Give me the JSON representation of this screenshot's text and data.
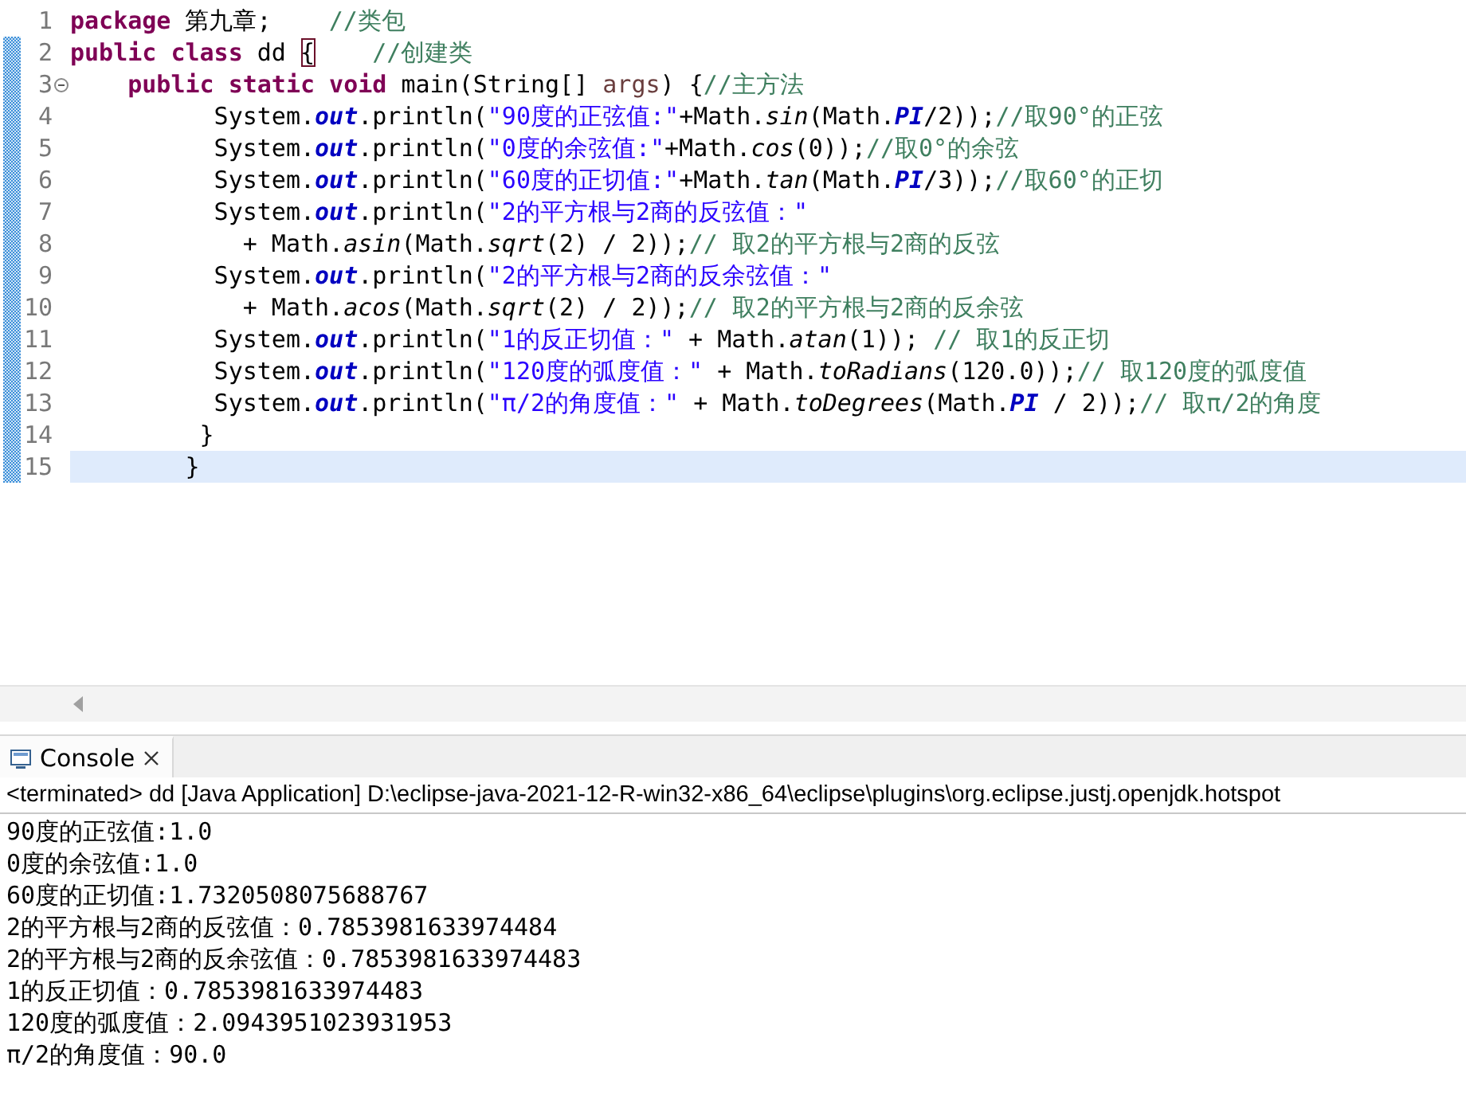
{
  "editor": {
    "lines": [
      {
        "number": "1",
        "changed": false,
        "current": false,
        "fold": false,
        "tokens": [
          {
            "kind": "keyword",
            "text": "package"
          },
          {
            "kind": "plain",
            "text": " 第九章;    "
          },
          {
            "kind": "comment",
            "text": "//类包"
          }
        ]
      },
      {
        "number": "2",
        "changed": true,
        "current": false,
        "fold": false,
        "tokens": [
          {
            "kind": "keyword",
            "text": "public class"
          },
          {
            "kind": "plain",
            "text": " dd "
          },
          {
            "kind": "bracket",
            "text": "{"
          },
          {
            "kind": "comment",
            "text": "    //创建类"
          }
        ]
      },
      {
        "number": "3",
        "changed": true,
        "current": false,
        "fold": true,
        "tokens": [
          {
            "kind": "keyword",
            "text": "    public static void"
          },
          {
            "kind": "plain",
            "text": " main(String[] "
          },
          {
            "kind": "param",
            "text": "args"
          },
          {
            "kind": "plain",
            "text": ") {"
          },
          {
            "kind": "comment",
            "text": "//主方法"
          }
        ]
      },
      {
        "number": "4",
        "changed": true,
        "current": false,
        "fold": false,
        "tokens": [
          {
            "kind": "plain",
            "text": "          System."
          },
          {
            "kind": "field",
            "text": "out"
          },
          {
            "kind": "plain",
            "text": ".println("
          },
          {
            "kind": "string",
            "text": "\"90度的正弦值:\""
          },
          {
            "kind": "plain",
            "text": "+Math."
          },
          {
            "kind": "method",
            "text": "sin"
          },
          {
            "kind": "plain",
            "text": "(Math."
          },
          {
            "kind": "field",
            "text": "PI"
          },
          {
            "kind": "plain",
            "text": "/2));"
          },
          {
            "kind": "comment",
            "text": "//取90°的正弦"
          }
        ]
      },
      {
        "number": "5",
        "changed": true,
        "current": false,
        "fold": false,
        "tokens": [
          {
            "kind": "plain",
            "text": "          System."
          },
          {
            "kind": "field",
            "text": "out"
          },
          {
            "kind": "plain",
            "text": ".println("
          },
          {
            "kind": "string",
            "text": "\"0度的余弦值:\""
          },
          {
            "kind": "plain",
            "text": "+Math."
          },
          {
            "kind": "method",
            "text": "cos"
          },
          {
            "kind": "plain",
            "text": "(0));"
          },
          {
            "kind": "comment",
            "text": "//取0°的余弦"
          }
        ]
      },
      {
        "number": "6",
        "changed": true,
        "current": false,
        "fold": false,
        "tokens": [
          {
            "kind": "plain",
            "text": "          System."
          },
          {
            "kind": "field",
            "text": "out"
          },
          {
            "kind": "plain",
            "text": ".println("
          },
          {
            "kind": "string",
            "text": "\"60度的正切值:\""
          },
          {
            "kind": "plain",
            "text": "+Math."
          },
          {
            "kind": "method",
            "text": "tan"
          },
          {
            "kind": "plain",
            "text": "(Math."
          },
          {
            "kind": "field",
            "text": "PI"
          },
          {
            "kind": "plain",
            "text": "/3));"
          },
          {
            "kind": "comment",
            "text": "//取60°的正切"
          }
        ]
      },
      {
        "number": "7",
        "changed": true,
        "current": false,
        "fold": false,
        "tokens": [
          {
            "kind": "plain",
            "text": "          System."
          },
          {
            "kind": "field",
            "text": "out"
          },
          {
            "kind": "plain",
            "text": ".println("
          },
          {
            "kind": "string",
            "text": "\"2的平方根与2商的反弦值：\""
          }
        ]
      },
      {
        "number": "8",
        "changed": true,
        "current": false,
        "fold": false,
        "tokens": [
          {
            "kind": "plain",
            "text": "            + Math."
          },
          {
            "kind": "method",
            "text": "asin"
          },
          {
            "kind": "plain",
            "text": "(Math."
          },
          {
            "kind": "method",
            "text": "sqrt"
          },
          {
            "kind": "plain",
            "text": "(2) / 2));"
          },
          {
            "kind": "comment",
            "text": "// 取2的平方根与2商的反弦"
          }
        ]
      },
      {
        "number": "9",
        "changed": true,
        "current": false,
        "fold": false,
        "tokens": [
          {
            "kind": "plain",
            "text": "          System."
          },
          {
            "kind": "field",
            "text": "out"
          },
          {
            "kind": "plain",
            "text": ".println("
          },
          {
            "kind": "string",
            "text": "\"2的平方根与2商的反余弦值：\""
          }
        ]
      },
      {
        "number": "10",
        "changed": true,
        "current": false,
        "fold": false,
        "tokens": [
          {
            "kind": "plain",
            "text": "            + Math."
          },
          {
            "kind": "method",
            "text": "acos"
          },
          {
            "kind": "plain",
            "text": "(Math."
          },
          {
            "kind": "method",
            "text": "sqrt"
          },
          {
            "kind": "plain",
            "text": "(2) / 2));"
          },
          {
            "kind": "comment",
            "text": "// 取2的平方根与2商的反余弦"
          }
        ]
      },
      {
        "number": "11",
        "changed": true,
        "current": false,
        "fold": false,
        "tokens": [
          {
            "kind": "plain",
            "text": "          System."
          },
          {
            "kind": "field",
            "text": "out"
          },
          {
            "kind": "plain",
            "text": ".println("
          },
          {
            "kind": "string",
            "text": "\"1的反正切值：\""
          },
          {
            "kind": "plain",
            "text": " + Math."
          },
          {
            "kind": "method",
            "text": "atan"
          },
          {
            "kind": "plain",
            "text": "(1)); "
          },
          {
            "kind": "comment",
            "text": "// 取1的反正切"
          }
        ]
      },
      {
        "number": "12",
        "changed": true,
        "current": false,
        "fold": false,
        "tokens": [
          {
            "kind": "plain",
            "text": "          System."
          },
          {
            "kind": "field",
            "text": "out"
          },
          {
            "kind": "plain",
            "text": ".println("
          },
          {
            "kind": "string",
            "text": "\"120度的弧度值：\""
          },
          {
            "kind": "plain",
            "text": " + Math."
          },
          {
            "kind": "method",
            "text": "toRadians"
          },
          {
            "kind": "plain",
            "text": "(120.0));"
          },
          {
            "kind": "comment",
            "text": "// 取120度的弧度值"
          }
        ]
      },
      {
        "number": "13",
        "changed": true,
        "current": false,
        "fold": false,
        "tokens": [
          {
            "kind": "plain",
            "text": "          System."
          },
          {
            "kind": "field",
            "text": "out"
          },
          {
            "kind": "plain",
            "text": ".println("
          },
          {
            "kind": "string",
            "text": "\"π/2的角度值：\""
          },
          {
            "kind": "plain",
            "text": " + Math."
          },
          {
            "kind": "method",
            "text": "toDegrees"
          },
          {
            "kind": "plain",
            "text": "(Math."
          },
          {
            "kind": "field",
            "text": "PI"
          },
          {
            "kind": "plain",
            "text": " / 2));"
          },
          {
            "kind": "comment",
            "text": "// 取π/2的角度"
          }
        ]
      },
      {
        "number": "14",
        "changed": true,
        "current": false,
        "fold": false,
        "tokens": [
          {
            "kind": "plain",
            "text": "         }"
          }
        ]
      },
      {
        "number": "15",
        "changed": true,
        "current": true,
        "fold": false,
        "tokens": [
          {
            "kind": "plain",
            "text": "        }"
          }
        ]
      }
    ]
  },
  "console": {
    "tab": {
      "label": "Console",
      "selected": true
    },
    "header": "<terminated> dd [Java Application] D:\\eclipse-java-2021-12-R-win32-x86_64\\eclipse\\plugins\\org.eclipse.justj.openjdk.hotspot",
    "output": [
      "90度的正弦值:1.0",
      "0度的余弦值:1.0",
      "60度的正切值:1.7320508075688767",
      "2的平方根与2商的反弦值：0.7853981633974484",
      "2的平方根与2商的反余弦值：0.7853981633974483",
      "1的反正切值：0.7853981633974483",
      "120度的弧度值：2.0943951023931953",
      "π/2的角度值：90.0"
    ]
  }
}
